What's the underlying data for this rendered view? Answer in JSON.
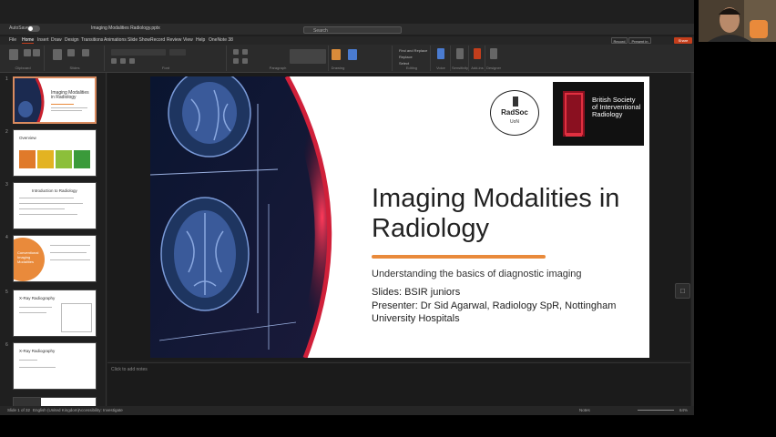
{
  "window": {
    "title": "Imaging Modalities Radiology.pptx",
    "autosave_label": "AutoSave",
    "autosave_state": "Off",
    "search_placeholder": "Search"
  },
  "menu": {
    "tabs": [
      "File",
      "Home",
      "Insert",
      "Draw",
      "Design",
      "Transitions",
      "Animations",
      "Slide Show",
      "Record",
      "Review",
      "View",
      "Help",
      "OneNote 38"
    ],
    "active_tab": "Home",
    "record_label": "Record",
    "present_label": "Present in Teams",
    "share_label": "Share"
  },
  "ribbon": {
    "groups": [
      "Clipboard",
      "Slides",
      "Font",
      "Paragraph",
      "Drawing",
      "Editing",
      "Voice",
      "Sensitivity",
      "Add-ins",
      "Designer"
    ],
    "editing_items": [
      "Find and Replace",
      "Replace",
      "Select"
    ]
  },
  "thumbnails": [
    {
      "num": "1",
      "title": "Imaging Modalities in Radiology"
    },
    {
      "num": "2",
      "title": "Overview"
    },
    {
      "num": "3",
      "title": "Introduction to Radiology"
    },
    {
      "num": "4",
      "title": "Conventional Imaging Modalities"
    },
    {
      "num": "5",
      "title": "X-Ray Radiography"
    },
    {
      "num": "6",
      "title": "X-Ray Radiography"
    }
  ],
  "slide": {
    "title": "Imaging Modalities in Radiology",
    "subtitle": "Understanding the basics of diagnostic imaging",
    "slides_credit": "Slides: BSIR juniors",
    "presenter": "Presenter: Dr Sid Agarwal, Radiology SpR, Nottingham University Hospitals",
    "logo_radsoc_line1": "RadSoc",
    "logo_radsoc_line2": "UoN",
    "logo_bsir_text": "British Society of Interventional Radiology",
    "accent_color": "#e98a3b"
  },
  "notes_placeholder": "Click to add notes",
  "status": {
    "slide_count": "Slide 1 of 32",
    "language": "English (United Kingdom)",
    "accessibility": "Accessibility: Investigate",
    "notes_label": "Notes",
    "zoom": "64%"
  }
}
